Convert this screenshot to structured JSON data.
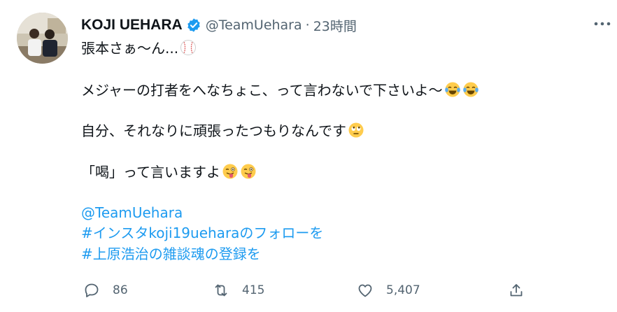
{
  "tweet": {
    "author_name": "KOJI UEHARA",
    "handle": "@TeamUehara",
    "separator": "·",
    "time": "23時間",
    "lines": {
      "l1": "張本さぁ〜ん...",
      "l2": "メジャーの打者をへなちょこ、って言わないで下さいよ〜",
      "l3": "自分、それなりに頑張ったつもりなんです",
      "l4": "「喝」って言いますよ",
      "mention": "@TeamUehara",
      "hashtag1": "#インスタkoji19ueharaのフォローを",
      "hashtag2": "#上原浩治の雑談魂の登録を"
    },
    "emojis": {
      "l1": [
        "baseball"
      ],
      "l2": [
        "face-with-tears-of-joy",
        "face-with-tears-of-joy"
      ],
      "l3": [
        "face-with-rolling-eyes"
      ],
      "l4": [
        "winking-face-with-tongue",
        "winking-face-with-tongue"
      ]
    }
  },
  "actions": {
    "replies": "86",
    "retweets": "415",
    "likes": "5,407"
  },
  "colors": {
    "text": "#0f1419",
    "secondary": "#536471",
    "link": "#1d9bf0",
    "verified": "#1d9bf0"
  }
}
